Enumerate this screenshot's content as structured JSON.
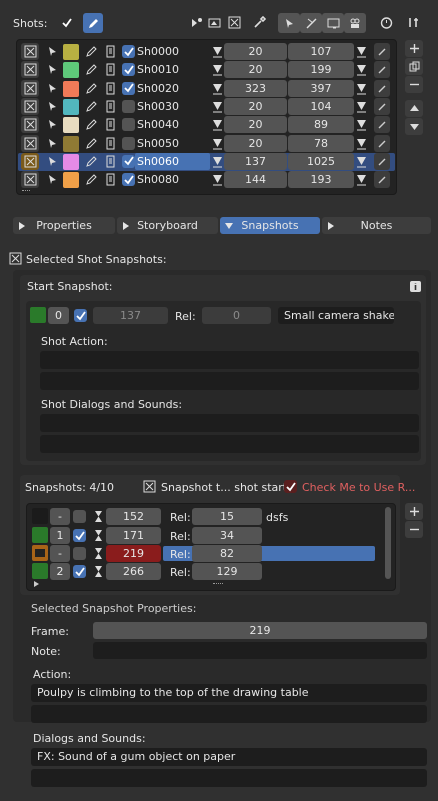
{
  "header": {
    "shots_label": "Shots:"
  },
  "shots": [
    {
      "name": "Sh0000",
      "color": "#b8b042",
      "start": "20",
      "end": "107",
      "enabled": true,
      "selected": false
    },
    {
      "name": "Sh0010",
      "color": "#5ec87a",
      "start": "20",
      "end": "199",
      "enabled": true,
      "selected": false
    },
    {
      "name": "Sh0020",
      "color": "#f07a58",
      "start": "323",
      "end": "397",
      "enabled": true,
      "selected": false
    },
    {
      "name": "Sh0030",
      "color": "#52b7be",
      "start": "20",
      "end": "104",
      "enabled": false,
      "selected": false
    },
    {
      "name": "Sh0040",
      "color": "#e8dcc0",
      "start": "20",
      "end": "89",
      "enabled": false,
      "selected": false
    },
    {
      "name": "Sh0050",
      "color": "#8f7a34",
      "start": "20",
      "end": "78",
      "enabled": false,
      "selected": false
    },
    {
      "name": "Sh0060",
      "color": "#e58ae6",
      "start": "137",
      "end": "1025",
      "enabled": true,
      "selected": true
    },
    {
      "name": "Sh0080",
      "color": "#f0a048",
      "start": "144",
      "end": "193",
      "enabled": true,
      "selected": false
    }
  ],
  "tabs": [
    {
      "label": "Properties",
      "active": false
    },
    {
      "label": "Storyboard",
      "active": false
    },
    {
      "label": "Snapshots",
      "active": true
    },
    {
      "label": "Notes",
      "active": false
    }
  ],
  "selected_shot": {
    "title": "Selected Shot Snapshots:"
  },
  "start_snapshot": {
    "title": "Start Snapshot:",
    "index": "0",
    "frame": "137",
    "rel_label": "Rel:",
    "rel": "0",
    "note": "Small camera shake",
    "action_label": "Shot Action:",
    "dialogs_label": "Shot Dialogs and Sounds:"
  },
  "snapshots": {
    "count_label": "Snapshots: 4/10",
    "snapshot_toggle_label": "Snapshot t... shot start",
    "check_me_label": "Check Me to Use R...",
    "rows": [
      {
        "index": "-",
        "frame": "152",
        "rel_label": "Rel:",
        "rel": "15",
        "note": "dsfs",
        "checked": false,
        "selected": false,
        "current": false
      },
      {
        "index": "1",
        "frame": "171",
        "rel_label": "Rel:",
        "rel": "34",
        "note": "",
        "checked": true,
        "selected": false,
        "current": false
      },
      {
        "index": "-",
        "frame": "219",
        "rel_label": "Rel:",
        "rel": "82",
        "note": "",
        "checked": false,
        "selected": true,
        "current": true
      },
      {
        "index": "2",
        "frame": "266",
        "rel_label": "Rel:",
        "rel": "129",
        "note": "",
        "checked": true,
        "selected": false,
        "current": false
      }
    ]
  },
  "selected_props": {
    "title": "Selected Snapshot Properties:",
    "frame_label": "Frame:",
    "frame_value": "219",
    "note_label": "Note:",
    "note_value": "",
    "action_label": "Action:",
    "action_value": "Poulpy is climbing to the top of the drawing table",
    "dialogs_label": "Dialogs and Sounds:",
    "dialogs_value": "FX: Sound of a gum object on paper"
  },
  "colors": {
    "accent": "#4772b3",
    "selected_frame": "#8a1c1c",
    "check_me_text": "#e06060"
  }
}
